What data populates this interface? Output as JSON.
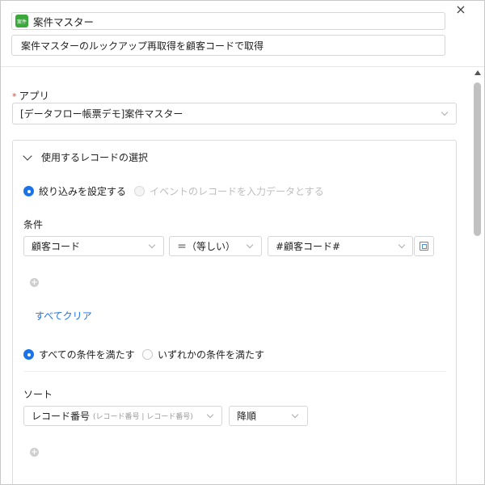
{
  "header": {
    "app_icon_text": "案件",
    "title": "案件マスター",
    "description": "案件マスターのルックアップ再取得を顧客コードで取得",
    "close_glyph": "×"
  },
  "app_field": {
    "required_mark": "*",
    "label": "アプリ",
    "value": "[データフロー帳票デモ]案件マスター"
  },
  "record_panel": {
    "title": "使用するレコードの選択",
    "radio_filter": {
      "label": "絞り込みを設定する",
      "selected": true
    },
    "radio_event": {
      "label": "イベントのレコードを入力データとする",
      "selected": false,
      "disabled": true
    },
    "condition": {
      "label": "条件",
      "field": "顧客コード",
      "operator": "＝（等しい）",
      "value": "#顧客コード#",
      "add_glyph": "+",
      "clear_label": "すべてクリア"
    },
    "match_all": {
      "label": "すべての条件を満たす",
      "selected": true
    },
    "match_any": {
      "label": "いずれかの条件を満たす",
      "selected": false
    },
    "sort": {
      "label": "ソート",
      "field": "レコード番号",
      "field_sub": "(レコード番号 | レコード番号)",
      "order": "降順",
      "add_glyph": "+"
    }
  },
  "colors": {
    "accent": "#1a73e8",
    "required": "#e0463c",
    "app_icon": "#3aa83a"
  }
}
